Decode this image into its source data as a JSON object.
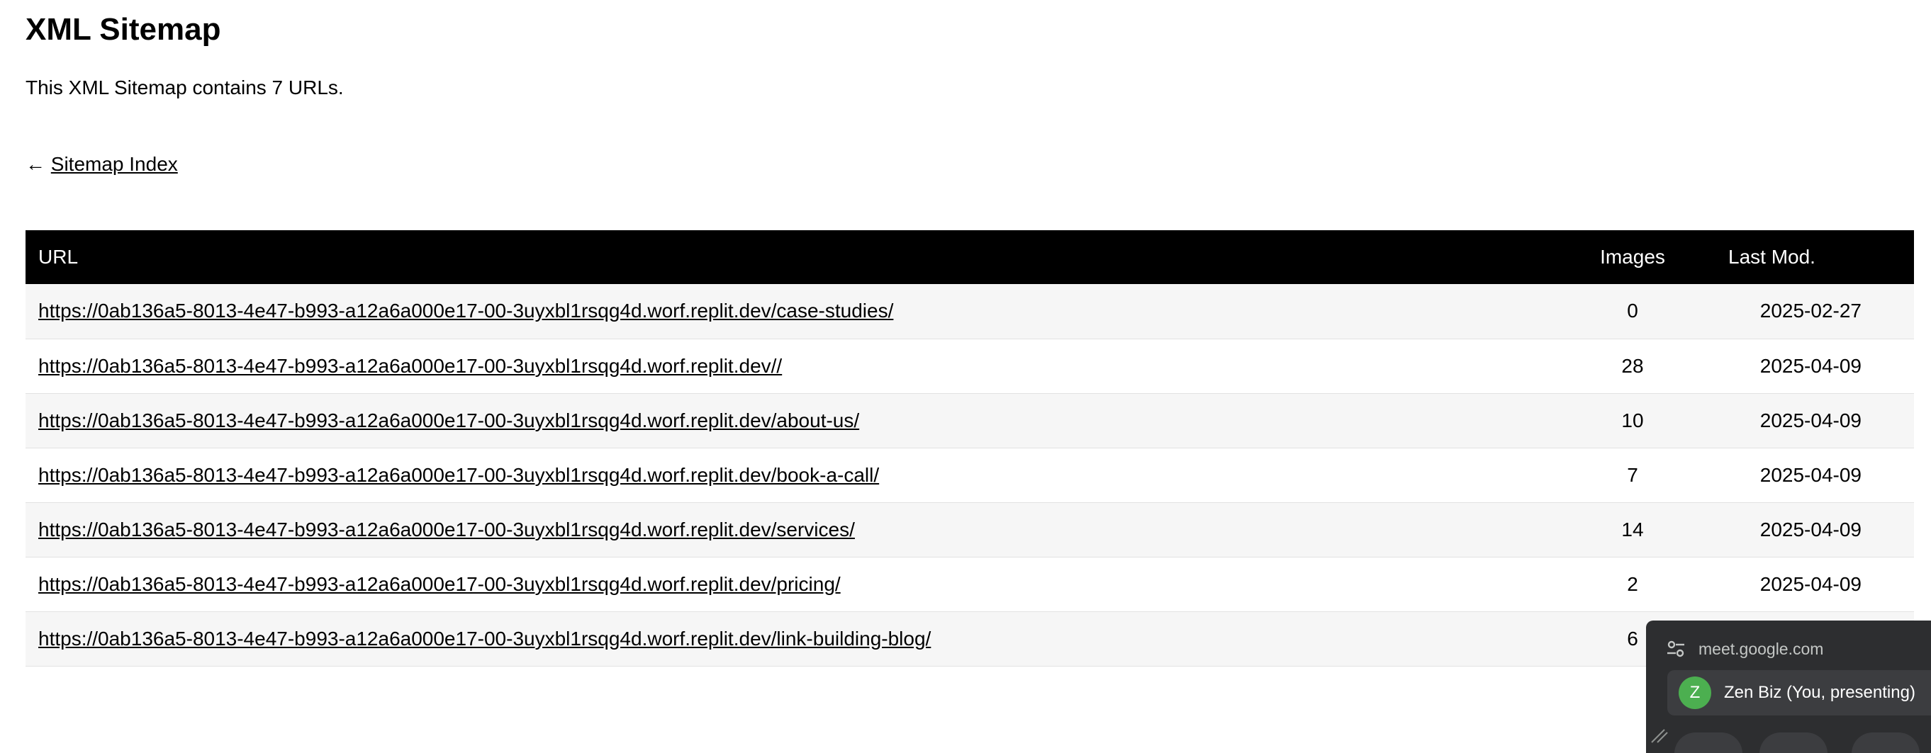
{
  "header": {
    "title": "XML Sitemap",
    "description": "This XML Sitemap contains 7 URLs.",
    "back_arrow": "←",
    "back_link": "Sitemap Index"
  },
  "table": {
    "columns": [
      "URL",
      "Images",
      "Last Mod."
    ],
    "rows": [
      {
        "url": "https://0ab136a5-8013-4e47-b993-a12a6a000e17-00-3uyxbl1rsqg4d.worf.replit.dev/case-studies/",
        "images": "0",
        "lastmod": "2025-02-27"
      },
      {
        "url": "https://0ab136a5-8013-4e47-b993-a12a6a000e17-00-3uyxbl1rsqg4d.worf.replit.dev//",
        "images": "28",
        "lastmod": "2025-04-09"
      },
      {
        "url": "https://0ab136a5-8013-4e47-b993-a12a6a000e17-00-3uyxbl1rsqg4d.worf.replit.dev/about-us/",
        "images": "10",
        "lastmod": "2025-04-09"
      },
      {
        "url": "https://0ab136a5-8013-4e47-b993-a12a6a000e17-00-3uyxbl1rsqg4d.worf.replit.dev/book-a-call/",
        "images": "7",
        "lastmod": "2025-04-09"
      },
      {
        "url": "https://0ab136a5-8013-4e47-b993-a12a6a000e17-00-3uyxbl1rsqg4d.worf.replit.dev/services/",
        "images": "14",
        "lastmod": "2025-04-09"
      },
      {
        "url": "https://0ab136a5-8013-4e47-b993-a12a6a000e17-00-3uyxbl1rsqg4d.worf.replit.dev/pricing/",
        "images": "2",
        "lastmod": "2025-04-09"
      },
      {
        "url": "https://0ab136a5-8013-4e47-b993-a12a6a000e17-00-3uyxbl1rsqg4d.worf.replit.dev/link-building-blog/",
        "images": "6",
        "lastmod": ""
      }
    ]
  },
  "meet_popup": {
    "domain": "meet.google.com",
    "domain_icon": "tune-icon",
    "avatar_letter": "Z",
    "presenter": "Zen Biz (You, presenting)",
    "avatar_color": "#4caf50"
  }
}
